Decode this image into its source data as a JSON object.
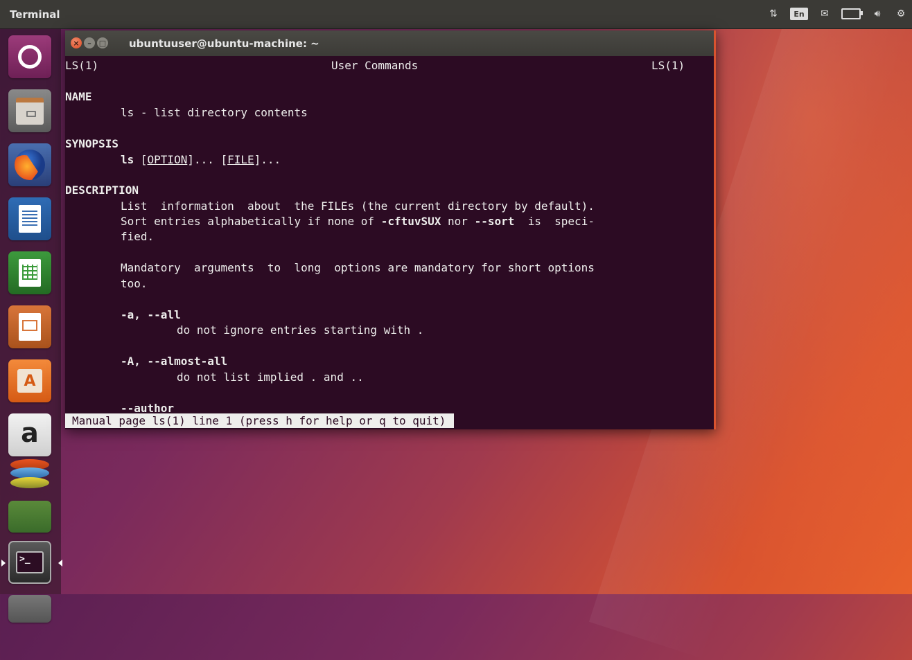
{
  "top_panel": {
    "app_title": "Terminal",
    "indicators": {
      "network_icon": "updown-arrows-icon",
      "keyboard_label": "En",
      "mail_icon": "envelope-icon",
      "battery_icon": "battery-icon",
      "sound_icon": "speaker-icon",
      "settings_icon": "gear-icon"
    }
  },
  "launcher": {
    "items": [
      "dash-home",
      "files",
      "firefox",
      "libreoffice-writer",
      "libreoffice-calc",
      "libreoffice-impress",
      "ubuntu-software",
      "amazon",
      "app-stack",
      "misc-app",
      "terminal",
      "more-apps"
    ],
    "amazon_letter": "a",
    "software_letter": "A",
    "terminal_prompt": ">_"
  },
  "window": {
    "title": "ubuntuuser@ubuntu-machine: ~",
    "buttons": {
      "close": "×",
      "minimize": "–",
      "maximize": "□"
    }
  },
  "man": {
    "header_left": "LS(1)",
    "header_center": "User Commands",
    "header_right": "LS(1)",
    "name_heading": "NAME",
    "name_text": "ls - list directory contents",
    "synopsis_heading": "SYNOPSIS",
    "synopsis_cmd": "ls",
    "synopsis_option": "OPTION",
    "synopsis_file": "FILE",
    "description_heading": "DESCRIPTION",
    "desc_line1": "List  information  about  the FILEs (the current directory by default).",
    "desc_line2_a": "Sort entries alphabetically if none of ",
    "desc_line2_flag1": "-cftuvSUX",
    "desc_line2_b": " nor ",
    "desc_line2_flag2": "--sort",
    "desc_line2_c": "  is  speci-",
    "desc_line3": "fied.",
    "mand_line1": "Mandatory  arguments  to  long  options are mandatory for short options",
    "mand_line2": "too.",
    "opt_all": "-a, --all",
    "opt_all_desc": "do not ignore entries starting with .",
    "opt_almost_all": "-A, --almost-all",
    "opt_almost_all_desc": "do not list implied . and ..",
    "opt_author": "--author",
    "status": "Manual page ls(1) line 1 (press h for help or q to quit)"
  },
  "colors": {
    "terminal_bg": "#2c0b23",
    "terminal_fg": "#eeeeec",
    "panel_bg": "#3b3a36",
    "accent": "#e8612c",
    "close_button": "#df4a22"
  }
}
